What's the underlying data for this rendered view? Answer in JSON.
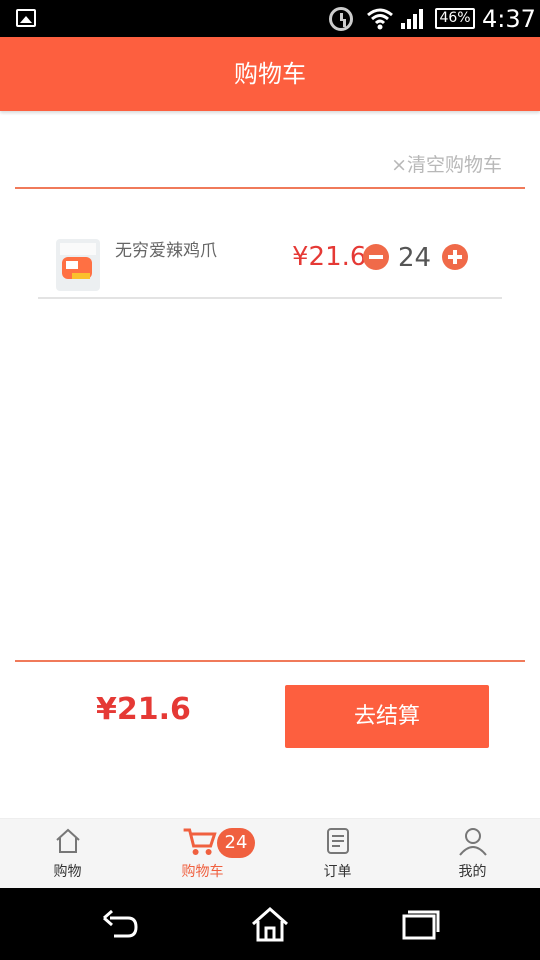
{
  "status_bar": {
    "battery": "46%",
    "time": "4:37"
  },
  "header": {
    "title": "购物车"
  },
  "cart": {
    "clear_label": "×清空购物车",
    "items": [
      {
        "name": "无穷爱辣鸡爪",
        "price": "¥21.6",
        "quantity": "24"
      }
    ]
  },
  "footer": {
    "total": "¥21.6",
    "checkout_label": "去结算"
  },
  "tabbar": {
    "items": [
      {
        "label": "购物",
        "icon": "home-icon"
      },
      {
        "label": "购物车",
        "icon": "cart-icon",
        "badge": "24"
      },
      {
        "label": "订单",
        "icon": "order-icon"
      },
      {
        "label": "我的",
        "icon": "user-icon"
      }
    ]
  },
  "colors": {
    "accent": "#fd5f3f",
    "price": "#e53935"
  }
}
